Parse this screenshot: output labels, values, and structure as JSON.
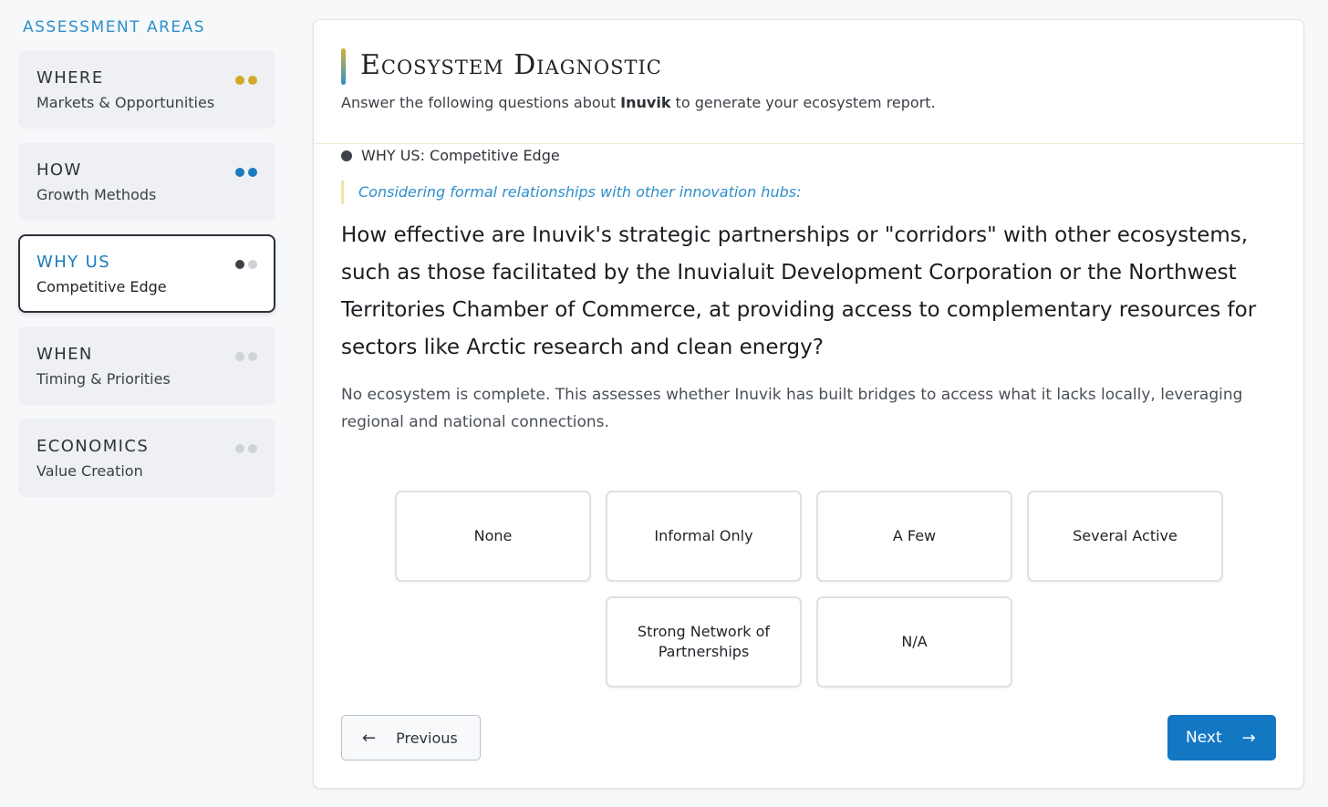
{
  "sidebar": {
    "heading": "ASSESSMENT AREAS",
    "areas": [
      {
        "name": "WHERE",
        "sub": "Markets & Opportunities",
        "dots": [
          "#d3a82b",
          "#d3a82b"
        ]
      },
      {
        "name": "HOW",
        "sub": "Growth Methods",
        "dots": [
          "#1a7bbf",
          "#1a7bbf"
        ]
      },
      {
        "name": "WHY US",
        "sub": "Competitive Edge",
        "dots": [
          "#3d4249",
          "#cfd3d8"
        ]
      },
      {
        "name": "WHEN",
        "sub": "Timing & Priorities",
        "dots": [
          "#cfd3d8",
          "#cfd3d8"
        ]
      },
      {
        "name": "ECONOMICS",
        "sub": "Value Creation",
        "dots": [
          "#cfd3d8",
          "#cfd3d8"
        ]
      }
    ]
  },
  "header": {
    "title": "Ecosystem Diagnostic",
    "subtitle_pre": "Answer the following questions about ",
    "subtitle_name": "Inuvik",
    "subtitle_post": " to generate your ecosystem report."
  },
  "question": {
    "section": "WHY US: Competitive Edge",
    "context": "Considering formal relationships with other innovation hubs:",
    "text": "How effective are Inuvik's strategic partnerships or \"corridors\" with other ecosystems, such as those facilitated by the Inuvialuit Development Corporation or the Northwest Territories Chamber of Commerce, at providing access to complementary resources for sectors like Arctic research and clean energy?",
    "description": "No ecosystem is complete. This assesses whether Inuvik has built bridges to access what it lacks locally, leveraging regional and national connections.",
    "options": [
      "None",
      "Informal Only",
      "A Few",
      "Several Active",
      "Strong Network of Partnerships",
      "N/A"
    ]
  },
  "nav": {
    "previous": "Previous",
    "next": "Next"
  },
  "icons": {
    "previous": "arrow-left-icon",
    "next": "arrow-right-icon"
  }
}
